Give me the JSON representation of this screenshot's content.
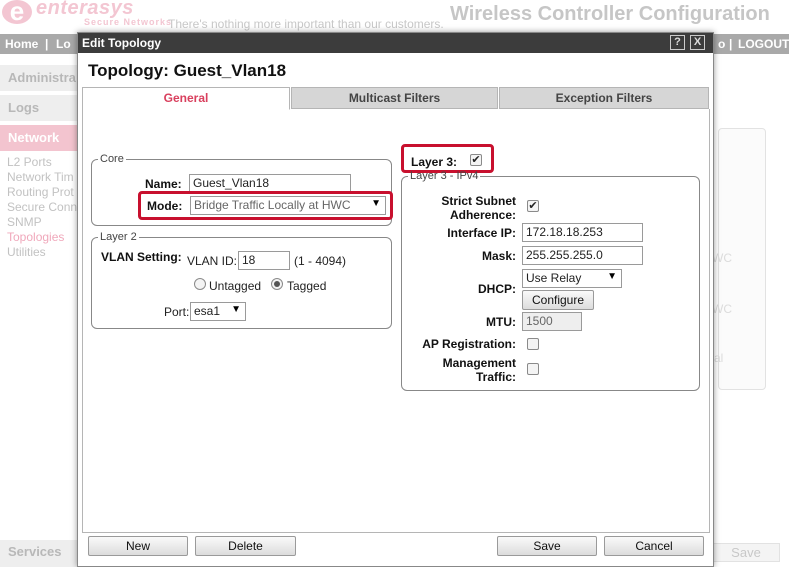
{
  "background": {
    "logo": {
      "brand": "enterasys",
      "sub": "Secure Networks",
      "mark": "e"
    },
    "tagline": "There's nothing more important than our customers.",
    "app_title": "Wireless Controller Configuration",
    "nav": {
      "home": "Home",
      "sep1": "|",
      "lo": "Lo",
      "o": "o",
      "sep2": "|",
      "logout": "LOGOUT"
    },
    "left_nav": {
      "administration": "Administra",
      "logs": "Logs",
      "network": "Network",
      "items": [
        "L2 Ports",
        "Network Tim",
        "Routing Prot",
        "Secure Conn",
        "SNMP",
        "Topologies",
        "Utilities"
      ],
      "services": "Services"
    },
    "right_fragments": [
      "WC",
      "WC",
      "al"
    ],
    "save_label": "Save"
  },
  "dialog": {
    "title": "Edit Topology",
    "help_label": "?",
    "close_label": "X",
    "topology_title": "Topology: Guest_Vlan18",
    "tabs": [
      "General",
      "Multicast Filters",
      "Exception Filters"
    ],
    "core": {
      "legend": "Core",
      "name_label": "Name:",
      "name_value": "Guest_Vlan18",
      "mode_label": "Mode:",
      "mode_value": "Bridge Traffic Locally at HWC"
    },
    "layer2": {
      "legend": "Layer 2",
      "vlan_setting_label": "VLAN Setting:",
      "vlan_id_label": "VLAN ID:",
      "vlan_id_value": "18",
      "vlan_range": "(1 - 4094)",
      "untagged_label": "Untagged",
      "tagged_label": "Tagged",
      "port_label": "Port:",
      "port_value": "esa1"
    },
    "layer3": {
      "label": "Layer 3:",
      "checked": true,
      "legend": "Layer 3 - IPv4",
      "strict_subnet_label_1": "Strict Subnet",
      "strict_subnet_label_2": "Adherence:",
      "interface_ip_label": "Interface IP:",
      "interface_ip_value": "172.18.18.253",
      "mask_label": "Mask:",
      "mask_value": "255.255.255.0",
      "dhcp_label": "DHCP:",
      "dhcp_value": "Use Relay",
      "configure_label": "Configure",
      "mtu_label": "MTU:",
      "mtu_value": "1500",
      "ap_registration_label": "AP Registration:",
      "management_label_1": "Management",
      "management_label_2": "Traffic:"
    },
    "buttons": {
      "new": "New",
      "delete": "Delete",
      "save": "Save",
      "cancel": "Cancel"
    },
    "check_glyph": "✔",
    "arrow_glyph": "▼"
  },
  "colors": {
    "accent": "#d9405e",
    "highlight": "#c8102e",
    "titlebar": "#3c3c3c",
    "navbar": "#a9a9a9"
  }
}
